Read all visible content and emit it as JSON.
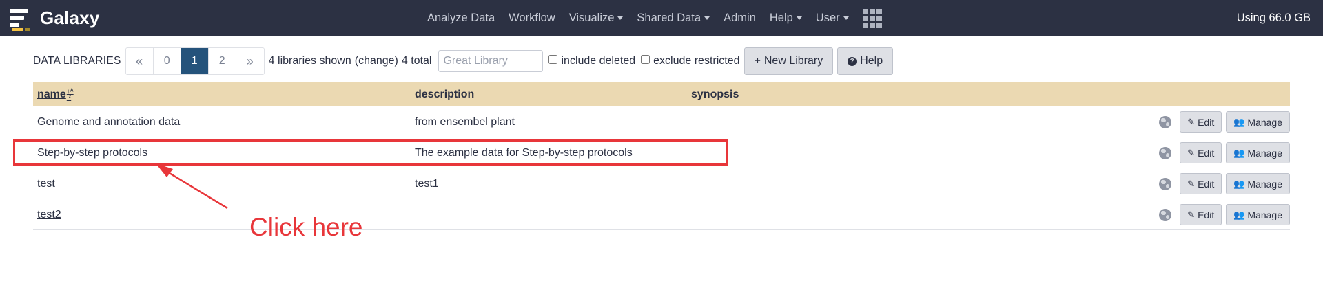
{
  "navbar": {
    "brand": "Galaxy",
    "items": [
      {
        "label": "Analyze Data",
        "dropdown": false
      },
      {
        "label": "Workflow",
        "dropdown": false
      },
      {
        "label": "Visualize",
        "dropdown": true
      },
      {
        "label": "Shared Data",
        "dropdown": true
      },
      {
        "label": "Admin",
        "dropdown": false
      },
      {
        "label": "Help",
        "dropdown": true
      },
      {
        "label": "User",
        "dropdown": true
      }
    ],
    "apps_icon": "grid-icon",
    "usage": "Using 66.0 GB"
  },
  "toolbar": {
    "breadcrumb": "DATA LIBRARIES",
    "pager": {
      "prev": "«",
      "pages": [
        "0",
        "1",
        "2"
      ],
      "active_page": "1",
      "next": "»"
    },
    "shown_text": "4 libraries shown",
    "change_link": "(change)",
    "total_text": "4 total",
    "search_placeholder": "Great Library",
    "include_deleted": "include deleted",
    "exclude_restricted": "exclude restricted",
    "new_library": "New Library",
    "help": "Help"
  },
  "table": {
    "headers": {
      "name": "name",
      "description": "description",
      "synopsis": "synopsis"
    },
    "rows": [
      {
        "name": "Genome and annotation data",
        "description": "from ensembel plant"
      },
      {
        "name": "Step-by-step protocols",
        "description": "The example data for Step-by-step protocols"
      },
      {
        "name": "test",
        "description": "test1"
      },
      {
        "name": "test2",
        "description": ""
      }
    ],
    "edit_label": "Edit",
    "manage_label": "Manage"
  },
  "annotation": {
    "label": "Click here",
    "color": "#e8363a"
  },
  "colors": {
    "navbar_bg": "#2c3143",
    "header_bg": "#ebd9b2",
    "active_page": "#25537b",
    "brand_accent": "#f6c343"
  }
}
